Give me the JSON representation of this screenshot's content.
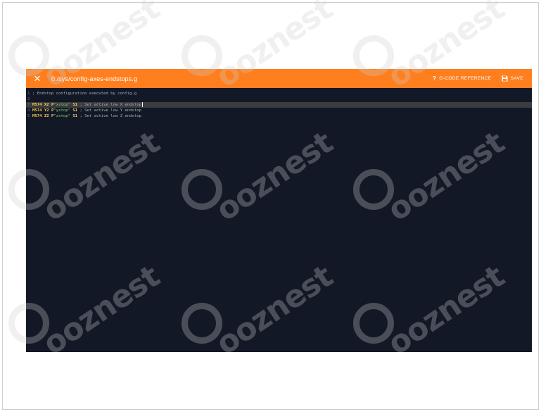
{
  "editor": {
    "file_path": "0:/sys/config-axes-endstops.g",
    "toolbar": {
      "close_icon": "close-icon",
      "gcode_reference_label": "G-CODE REFERENCE",
      "gcode_reference_icon": "question-icon",
      "save_label": "SAVE",
      "save_icon": "floppy-disk-icon"
    },
    "colors": {
      "toolbar": "#ff7f1f",
      "background": "#121826",
      "active_line": "#3a3c40"
    },
    "lines": [
      {
        "number": "1",
        "text": "; Endstop configuration executed by config.g"
      },
      {
        "number": "2",
        "text": ""
      },
      {
        "number": "3",
        "cmd": "M574",
        "axis": "X2",
        "param_p": "P",
        "str": "\"xstop\"",
        "param_s": "S1",
        "comment": "; Set active low X endstop"
      },
      {
        "number": "4",
        "cmd": "M574",
        "axis": "Y2",
        "param_p": "P",
        "str": "\"ystop\"",
        "param_s": "S1",
        "comment": "; Set active low Y endstop"
      },
      {
        "number": "5",
        "cmd": "M574",
        "axis": "Z2",
        "param_p": "P",
        "str": "\"zstop\"",
        "param_s": "S1",
        "comment": "; Set active low Z endstop"
      }
    ],
    "active_line": 3
  },
  "watermark": {
    "text": "ooznest"
  }
}
